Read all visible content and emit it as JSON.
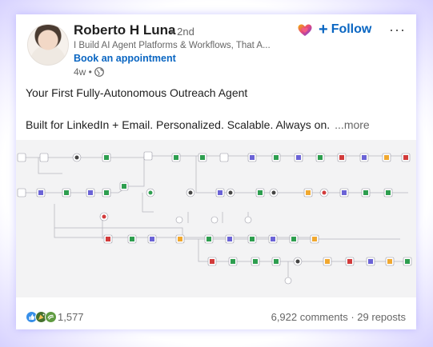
{
  "author": {
    "name": "Roberto H Luna",
    "degree": "• 2nd",
    "headline": "I Build AI Agent Platforms & Workflows, That A...",
    "cta": "Book an appointment",
    "time": "4w •"
  },
  "actions": {
    "follow_label": "Follow"
  },
  "post": {
    "title": "Your First Fully-Autonomous Outreach Agent",
    "body": "Built for LinkedIn + Email. Personalized. Scalable. Always on.",
    "see_more": "...more"
  },
  "social": {
    "reaction_count": "1,577",
    "comments": "6,922 comments",
    "separator": "·",
    "reposts": "29 reposts"
  },
  "colors": {
    "accent": "#0a66c2",
    "node_green": "#2e9e4f",
    "node_purple": "#6b63d6",
    "node_orange": "#f0a830",
    "node_red": "#d23b3b"
  }
}
